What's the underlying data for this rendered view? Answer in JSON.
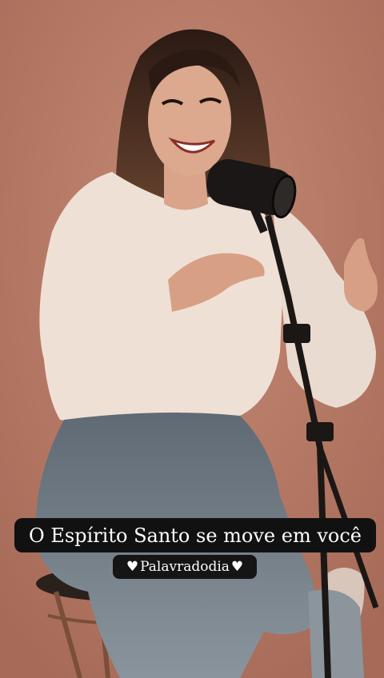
{
  "story": {
    "caption": "O Espírito Santo se move em você",
    "hashtag": "Palavradodia",
    "heart_glyph": "♥",
    "colors": {
      "background": "#b87a66",
      "caption_bg": "#111111",
      "caption_text": "#ffffff"
    }
  }
}
